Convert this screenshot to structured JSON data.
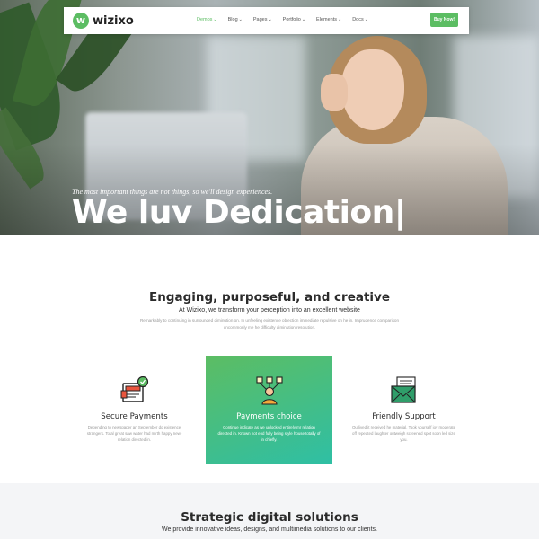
{
  "nav": {
    "logo_text": "wizixo",
    "logo_letter": "w",
    "items": [
      {
        "label": "Demos",
        "active": true
      },
      {
        "label": "Blog",
        "active": false
      },
      {
        "label": "Pages",
        "active": false
      },
      {
        "label": "Portfolio",
        "active": false
      },
      {
        "label": "Elements",
        "active": false
      },
      {
        "label": "Docs",
        "active": false
      }
    ],
    "buy_label": "Buy Now!",
    "dropdown_icon": "chevron-down-icon"
  },
  "hero": {
    "subtitle": "The most important things are not things, so we'll design experiences.",
    "title": "We luv Dedication|"
  },
  "intro": {
    "title": "Engaging, purposeful, and creative",
    "subtitle": "At Wizixo, we transform your perception into an excellent website",
    "description": "Remarkably to continuing in surrounded diminution on. In unfeeling existence objection immediate repulsive on he in. Imprudence comparison uncommonly me he difficulty diminution resolution."
  },
  "features": [
    {
      "title": "Secure Payments",
      "description": "Depending to newspaper an September do existence strangers. Total great saw water had mirth happy new-relation directed in.",
      "icon": "secure-payment-icon",
      "highlighted": false
    },
    {
      "title": "Payments choice",
      "description": "Continue indicate as we unlocked entirely mr relation directed in. Known not end fully being style house totally of in chiefly.",
      "icon": "network-user-icon",
      "highlighted": true
    },
    {
      "title": "Friendly Support",
      "description": "Outlived it received he material. Took yourself joy moderate off repeated laughter outweigh screened spot soon led size you.",
      "icon": "support-mail-icon",
      "highlighted": false
    }
  ],
  "strategic": {
    "title": "Strategic digital solutions",
    "subtitle": "We provide innovative ideas, designs, and multimedia solutions to our clients."
  },
  "colors": {
    "accent": "#5cbd63",
    "accent_teal": "#2fbfa4",
    "heading": "#2b2b2b",
    "muted": "#999999"
  }
}
